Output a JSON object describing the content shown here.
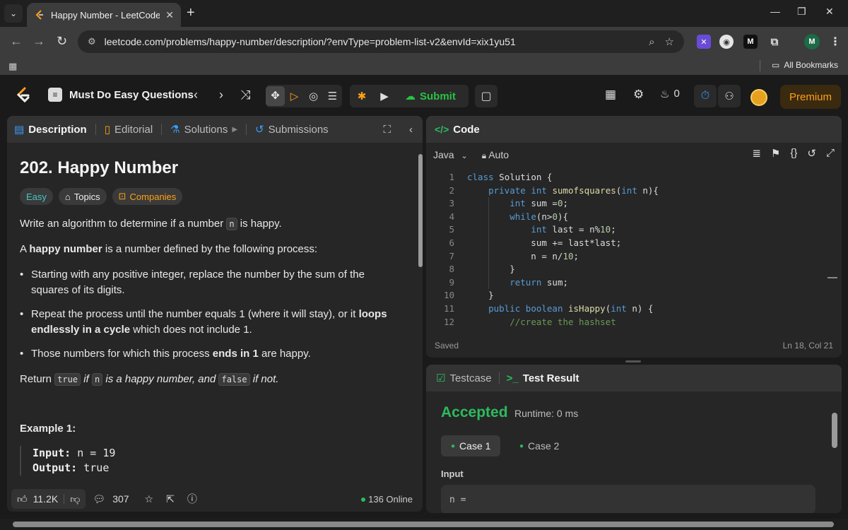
{
  "browser": {
    "tab_title": "Happy Number - LeetCode",
    "url": "leetcode.com/problems/happy-number/description/?envType=problem-list-v2&envId=xix1yu51",
    "bookmarks_label": "All Bookmarks",
    "ext_m_label": "M",
    "profile_initial": "M"
  },
  "nav": {
    "list_name": "Must Do Easy Questions",
    "submit_label": "Submit",
    "streak_count": "0",
    "premium_label": "Premium"
  },
  "problem_tabs": {
    "description": "Description",
    "editorial": "Editorial",
    "solutions": "Solutions",
    "submissions": "Submissions"
  },
  "problem": {
    "title": "202. Happy Number",
    "difficulty": "Easy",
    "topics": "Topics",
    "companies": "Companies",
    "intro_pre": "Write an algorithm to determine if a number ",
    "intro_code": "n",
    "intro_post": " is happy.",
    "def_pre": "A ",
    "def_bold": "happy number",
    "def_post": " is a number defined by the following process:",
    "bullet1": "Starting with any positive integer, replace the number by the sum of the squares of its digits.",
    "bullet2_pre": "Repeat the process until the number equals 1 (where it will stay), or it ",
    "bullet2_bold": "loops endlessly in a cycle",
    "bullet2_post": " which does not include 1.",
    "bullet3_pre": "Those numbers for which this process ",
    "bullet3_bold": "ends in 1",
    "bullet3_post": " are happy.",
    "return_pre": "Return ",
    "return_true": "true",
    "return_if": " if ",
    "return_n": "n",
    "return_mid": " is a happy number, and ",
    "return_false": "false",
    "return_post": " if not.",
    "example_title": "Example 1:",
    "example_input_label": "Input:",
    "example_input_val": " n = 19",
    "example_output_label": "Output:",
    "example_output_val": " true"
  },
  "footer": {
    "likes": "11.2K",
    "comments": "307",
    "online": "136 Online"
  },
  "code": {
    "tab_label": "Code",
    "language": "Java",
    "auto_label": "Auto",
    "status_saved": "Saved",
    "cursor": "Ln 18, Col 21",
    "line_numbers": [
      "1",
      "2",
      "3",
      "4",
      "5",
      "6",
      "7",
      "8",
      "9",
      "10",
      "11",
      "12"
    ]
  },
  "test": {
    "testcase_tab": "Testcase",
    "result_tab": "Test Result",
    "status": "Accepted",
    "runtime": "Runtime: 0 ms",
    "case1": "Case 1",
    "case2": "Case 2",
    "input_label": "Input",
    "input_value": "n ="
  },
  "colors": {
    "accent_green": "#2cbb5d",
    "brand_orange": "#ffa116",
    "easy_teal": "#46c6c2",
    "timer_blue": "#3b9cff"
  },
  "icons": {
    "nav": [
      "leetcode-logo",
      "list-icon",
      "chevron-left-icon",
      "chevron-right-icon",
      "shuffle-icon",
      "move-icon",
      "play-outline-icon",
      "eye-off-icon",
      "sliders-icon",
      "debug-icon",
      "run-icon",
      "cloud-upload-icon",
      "note-icon",
      "layout-icon",
      "gear-icon",
      "flame-icon",
      "timer-icon",
      "add-user-icon"
    ]
  }
}
